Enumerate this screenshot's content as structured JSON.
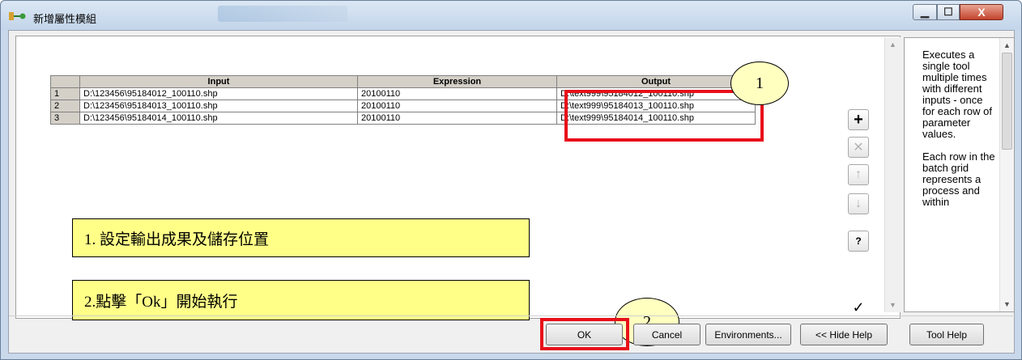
{
  "window": {
    "title": "新增屬性模組",
    "controls": {
      "minimize": "▁",
      "maximize": "☐",
      "close": "X"
    }
  },
  "grid": {
    "columns": [
      "Input",
      "Expression",
      "Output"
    ],
    "rows": [
      {
        "num": "1",
        "input": "D:\\123456\\95184012_100110.shp",
        "expression": "20100110",
        "output": "D:\\text999\\95184012_100110.shp"
      },
      {
        "num": "2",
        "input": "D:\\123456\\95184013_100110.shp",
        "expression": "20100110",
        "output": "D:\\text999\\95184013_100110.shp"
      },
      {
        "num": "3",
        "input": "D:\\123456\\95184014_100110.shp",
        "expression": "20100110",
        "output": "D:\\text999\\95184014_100110.shp"
      }
    ]
  },
  "annotations": {
    "circle1": "1",
    "circle2": "2",
    "note1": "1. 設定輸出成果及儲存位置",
    "note2": "2.點擊「Ok」開始執行"
  },
  "side_buttons": {
    "add": "+",
    "remove": "✕",
    "move_up": "↑",
    "move_down": "↓",
    "check_values": "?",
    "check": "✓"
  },
  "help": {
    "paragraph1": "Executes a single tool multiple times with different inputs - once for each row of parameter values.",
    "paragraph2": "Each row in the batch grid represents a process and within"
  },
  "buttons": {
    "ok": "OK",
    "cancel": "Cancel",
    "environments": "Environments...",
    "hide_help": "<< Hide Help",
    "tool_help": "Tool Help"
  },
  "colors": {
    "highlight": "#e8101a",
    "note_bg": "#ffff88",
    "circle_bg": "#ffffc0"
  }
}
